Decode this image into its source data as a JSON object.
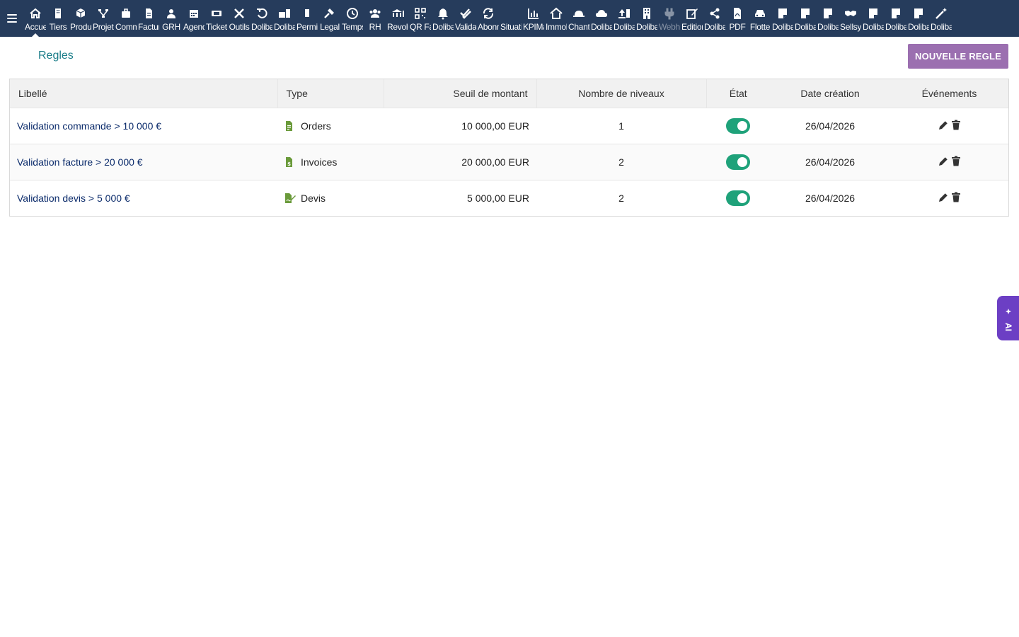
{
  "topbar": {
    "items": [
      {
        "label": "Accueil",
        "icon": "home-icon"
      },
      {
        "label": "Tiers",
        "icon": "building-icon"
      },
      {
        "label": "Produits",
        "icon": "cube-icon"
      },
      {
        "label": "Projets",
        "icon": "sitemap-icon"
      },
      {
        "label": "Commerce",
        "icon": "briefcase-icon"
      },
      {
        "label": "Facturation",
        "icon": "invoice-icon"
      },
      {
        "label": "GRH",
        "icon": "user-tie-icon"
      },
      {
        "label": "Agenda",
        "icon": "calendar-icon"
      },
      {
        "label": "Tickets",
        "icon": "ticket-icon"
      },
      {
        "label": "Outils",
        "icon": "tools-icon"
      },
      {
        "label": "Dolibarr",
        "icon": "undo-icon"
      },
      {
        "label": "Dolibarr",
        "icon": "suitcase-icon"
      },
      {
        "label": "Permissions",
        "icon": "flag-icon"
      },
      {
        "label": "Legal",
        "icon": "gavel-icon"
      },
      {
        "label": "Temps",
        "icon": "clock-icon"
      },
      {
        "label": "RH",
        "icon": "users-icon"
      },
      {
        "label": "Revolut",
        "icon": "bank-icon"
      },
      {
        "label": "QR Factures",
        "icon": "qrcode-icon"
      },
      {
        "label": "Dolibarr",
        "icon": "bell-icon"
      },
      {
        "label": "Validation",
        "icon": "check-double-icon"
      },
      {
        "label": "Abonnements",
        "icon": "sync-icon"
      },
      {
        "label": "Situation",
        "icon": "blank-icon"
      },
      {
        "label": "KPIManager",
        "icon": "chart-bar-icon"
      },
      {
        "label": "Immobilier",
        "icon": "house-icon"
      },
      {
        "label": "Chantier",
        "icon": "hard-hat-icon"
      },
      {
        "label": "Dolibarr",
        "icon": "cloud-icon"
      },
      {
        "label": "Dolibarr",
        "icon": "upload-icon"
      },
      {
        "label": "Dolibarr",
        "icon": "office-building-icon"
      },
      {
        "label": "Webhooks",
        "icon": "plug-icon"
      },
      {
        "label": "Edition",
        "icon": "edit-icon"
      },
      {
        "label": "Dolibarr",
        "icon": "share-icon"
      },
      {
        "label": "PDF",
        "icon": "file-pdf-icon"
      },
      {
        "label": "Flotte",
        "icon": "car-icon"
      },
      {
        "label": "Dolibarr",
        "icon": "note-icon"
      },
      {
        "label": "Dolibarr",
        "icon": "note-icon"
      },
      {
        "label": "Dolibarr",
        "icon": "note-icon"
      },
      {
        "label": "Sellsy",
        "icon": "handshake-icon"
      },
      {
        "label": "Dolibarr",
        "icon": "note-icon"
      },
      {
        "label": "Dolibarr",
        "icon": "note-icon"
      },
      {
        "label": "Dolibarr",
        "icon": "note-icon"
      },
      {
        "label": "Dolibarr",
        "icon": "magic-icon"
      }
    ]
  },
  "page": {
    "title": "Regles",
    "new_button": "NOUVELLE REGLE"
  },
  "table": {
    "headers": {
      "label": "Libellé",
      "type": "Type",
      "threshold": "Seuil de montant",
      "levels": "Nombre de niveaux",
      "state": "État",
      "created": "Date création",
      "events": "Événements"
    },
    "rows": [
      {
        "label": "Validation commande > 10 000 €",
        "type": "Orders",
        "type_icon": "file-invoice-icon",
        "threshold": "10 000,00 EUR",
        "levels": "1",
        "active": true,
        "created": "26/04/2026"
      },
      {
        "label": "Validation facture > 20 000 €",
        "type": "Invoices",
        "type_icon": "file-invoice-dollar-icon",
        "threshold": "20 000,00 EUR",
        "levels": "2",
        "active": true,
        "created": "26/04/2026"
      },
      {
        "label": "Validation devis > 5 000 €",
        "type": "Devis",
        "type_icon": "file-signature-icon",
        "threshold": "5 000,00 EUR",
        "levels": "2",
        "active": true,
        "created": "26/04/2026"
      }
    ]
  },
  "ai_tab": {
    "label": "AI"
  },
  "colors": {
    "topbar": "#263c5c",
    "title": "#1b7d89",
    "button": "#9b6fb0",
    "toggle_on": "#1fa27a",
    "link": "#0b2b6b",
    "type_icon": "#6a9a3a",
    "ai_tab": "#6c3fc4"
  }
}
